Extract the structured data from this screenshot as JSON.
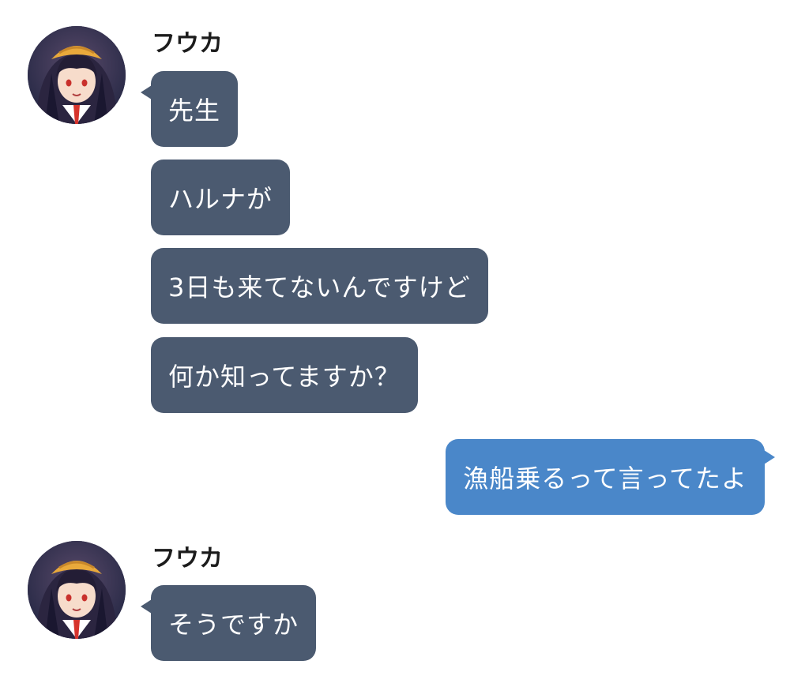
{
  "colors": {
    "incoming_bubble": "#4b5a70",
    "outgoing_bubble": "#4a87c9",
    "bubble_text": "#ffffff",
    "sender_name": "#1c1c1c",
    "background": "#ffffff"
  },
  "conversation": {
    "group1": {
      "sender": "フウカ",
      "avatar_icon": "character-portrait-avatar",
      "messages": [
        "先生",
        "ハルナが",
        "3日も来てないんですけど",
        "何か知ってますか？"
      ]
    },
    "reply": {
      "text": "漁船乗るって言ってたよ"
    },
    "group2": {
      "sender": "フウカ",
      "avatar_icon": "character-portrait-avatar",
      "messages": [
        "そうですか"
      ]
    }
  }
}
